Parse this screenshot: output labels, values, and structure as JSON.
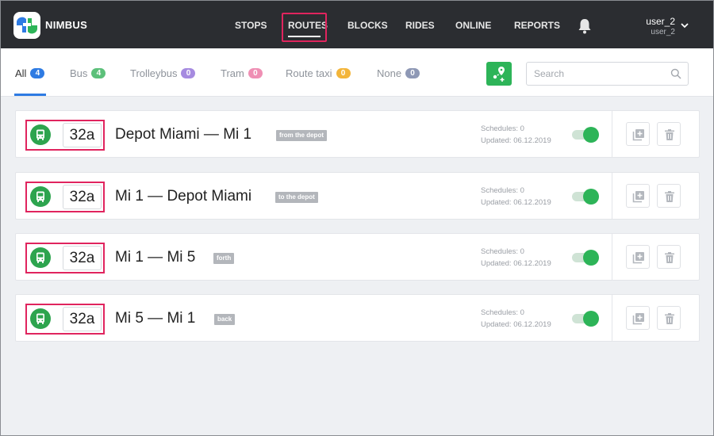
{
  "app": {
    "brand": "NIMBUS",
    "nav": [
      "STOPS",
      "ROUTES",
      "BLOCKS",
      "RIDES",
      "ONLINE",
      "REPORTS"
    ],
    "active_nav": "ROUTES",
    "user": {
      "name": "user_2",
      "login": "user_2"
    }
  },
  "filters": {
    "tabs": [
      {
        "label": "All",
        "count": "4",
        "color": "#2e7be3"
      },
      {
        "label": "Bus",
        "count": "4",
        "color": "#5cc07a"
      },
      {
        "label": "Trolleybus",
        "count": "0",
        "color": "#a68be0"
      },
      {
        "label": "Tram",
        "count": "0",
        "color": "#ef8fb4"
      },
      {
        "label": "Route taxi",
        "count": "0",
        "color": "#f3b53a"
      },
      {
        "label": "None",
        "count": "0",
        "color": "#8e98b5"
      }
    ],
    "search_placeholder": "Search"
  },
  "routes": [
    {
      "number": "32a",
      "name": "Depot Miami — Mi 1",
      "direction": "from the depot",
      "schedules": "Schedules: 0",
      "updated": "Updated: 06.12.2019",
      "enabled": true
    },
    {
      "number": "32a",
      "name": "Mi 1 — Depot Miami",
      "direction": "to the depot",
      "schedules": "Schedules: 0",
      "updated": "Updated: 06.12.2019",
      "enabled": true
    },
    {
      "number": "32a",
      "name": "Mi 1 — Mi 5",
      "direction": "forth",
      "schedules": "Schedules: 0",
      "updated": "Updated: 06.12.2019",
      "enabled": true
    },
    {
      "number": "32a",
      "name": "Mi 5 — Mi 1",
      "direction": "back",
      "schedules": "Schedules: 0",
      "updated": "Updated: 06.12.2019",
      "enabled": true
    }
  ],
  "colors": {
    "topbar": "#2b2d31",
    "accent_green": "#2db458",
    "highlight": "#e0245e"
  }
}
